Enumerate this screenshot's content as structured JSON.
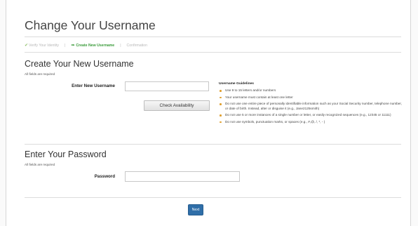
{
  "page": {
    "title": "Change Your Username"
  },
  "steps": [
    {
      "label": "Verify Your Identity",
      "state": "done",
      "icon": "check-icon"
    },
    {
      "label": "Create New Username",
      "state": "active",
      "icon": "arrow-right-icon"
    },
    {
      "label": "Confirmation",
      "state": "pending"
    }
  ],
  "username_section": {
    "heading": "Create Your New Username",
    "required_note": "All fields are required",
    "field_label": "Enter New Username",
    "field_value": "",
    "check_button": "Check Availability"
  },
  "guidelines": {
    "title": "Username Guidelines",
    "items": [
      "Use 9 to 15 letters and/or numbers",
      "Your username must contain at least one letter",
      "Do not use one entire piece of personally identifiable information such as your Social Security number, telephone number, or date of birth. Instead, alter or disguise it (e.g., Jane2125smith)",
      "Do not use 5 or more instances of a single number or letter, or easily recognized sequences (e.g., 12345 or 11111)",
      "Do not use symbols, punctuation marks, or spaces (e.g., #,@, /, *, - )"
    ]
  },
  "password_section": {
    "heading": "Enter Your Password",
    "required_note": "All fields are required",
    "field_label": "Password",
    "field_value": ""
  },
  "actions": {
    "next_label": "Next"
  },
  "colors": {
    "active_step": "#3a9b3a",
    "bullet": "#e0a030",
    "primary_button": "#2f6ea8"
  }
}
